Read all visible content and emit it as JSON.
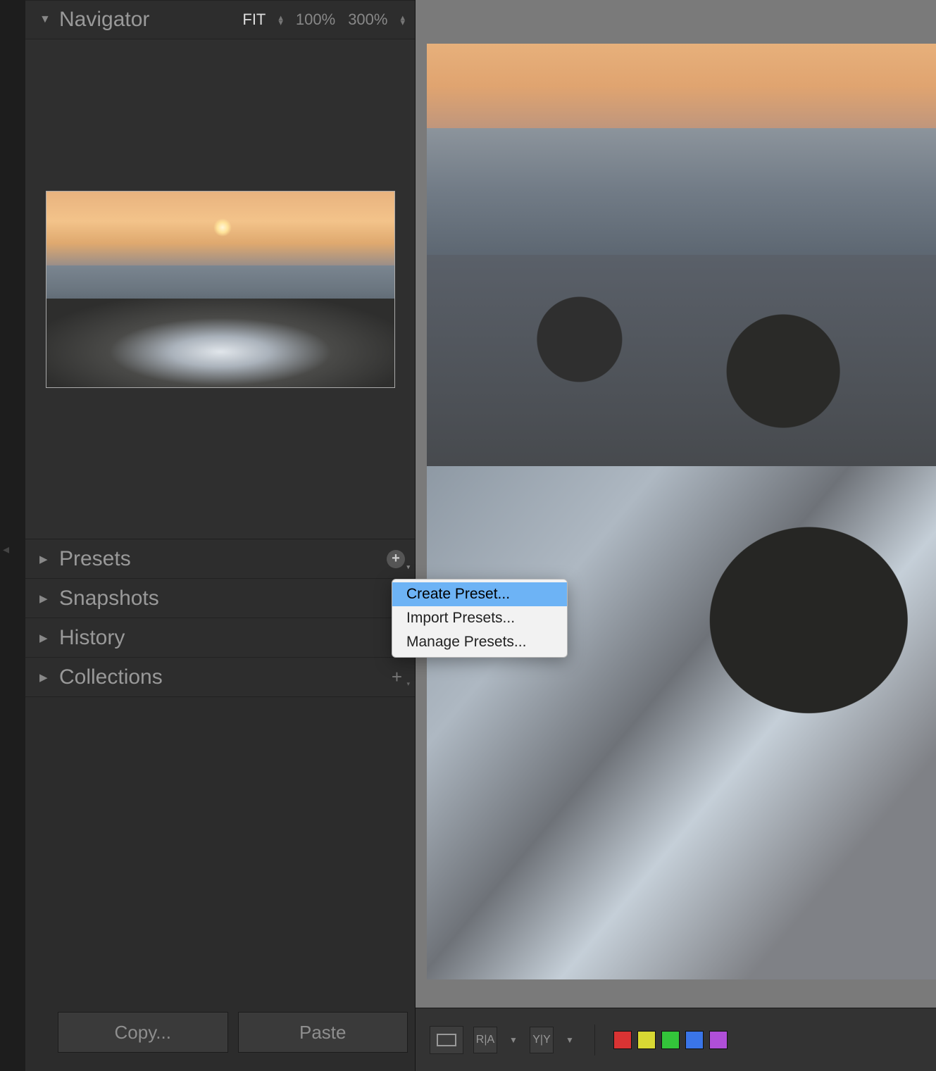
{
  "navigator": {
    "title": "Navigator",
    "zoom": {
      "fit": "FIT",
      "z100": "100%",
      "z300": "300%"
    }
  },
  "panels": {
    "presets": "Presets",
    "snapshots": "Snapshots",
    "history": "History",
    "collections": "Collections"
  },
  "footer": {
    "copy": "Copy...",
    "paste": "Paste"
  },
  "context_menu": {
    "create": "Create Preset...",
    "import": "Import Presets...",
    "manage": "Manage Presets..."
  },
  "toolbar": {
    "before_after_1": "R|A",
    "before_after_2": "Y|Y"
  },
  "colors": {
    "red": "#d93333",
    "yellow": "#d8d833",
    "green": "#33c43a",
    "blue": "#3a75e8",
    "purple": "#b04fd8"
  }
}
